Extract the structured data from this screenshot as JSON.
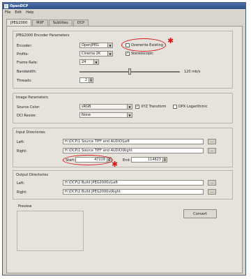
{
  "window": {
    "title": "OpenDCP"
  },
  "menu": [
    "File",
    "Edit",
    "Help"
  ],
  "tabs": [
    "JPEG2000",
    "MXF",
    "Subtitles",
    "DCP"
  ],
  "encoder_group": {
    "title": "JPEG2000 Encoder Parameters",
    "encoder_label": "Encoder:",
    "encoder_value": "OpenJPEG",
    "overwrite_label": "Overwrite Existing",
    "profile_label": "Profile:",
    "profile_value": "Cinema 2K",
    "stereoscopic_label": "Stereoscopic",
    "stereoscopic_checked": "✓",
    "framerate_label": "Frame Rate:",
    "framerate_value": "24",
    "bandwidth_label": "Bandwidth:",
    "bandwidth_value": "120 mb/s",
    "bandwidth_fraction": 0.5,
    "threads_label": "Threads:",
    "threads_value": "2"
  },
  "image_group": {
    "title": "Image Parameters",
    "source_color_label": "Source Color:",
    "source_color_value": "sRGB",
    "xyz_label": "XYZ Transform",
    "xyz_checked": "✓",
    "dpx_label": "DPX Logarithmic",
    "dci_resize_label": "DCI Resize:",
    "dci_resize_value": "None"
  },
  "input_group": {
    "title": "Input Directories",
    "left_label": "Left:",
    "left_value": "H:\\DCP\\1 Source TIFF and AUDIO\\Left",
    "right_label": "Right:",
    "right_value": "H:\\DCP\\1 Source TIFF and AUDIO\\Right",
    "browse_label": "...",
    "start_label": "Start:",
    "start_value": "47228",
    "end_label": "End:",
    "end_value": "114623"
  },
  "output_group": {
    "title": "Output Directories",
    "left_label": "Left:",
    "left_value": "H:\\DCP\\2 Build JPEG2000s\\Left",
    "right_label": "Right:",
    "right_value": "H:\\DCP\\2 Build JPEG2000s\\Right",
    "browse_label": "..."
  },
  "preview": {
    "title": "Preview"
  },
  "convert_label": "Convert",
  "colors": {
    "annotation": "#d41818",
    "titlebar": "#2c4f86"
  }
}
